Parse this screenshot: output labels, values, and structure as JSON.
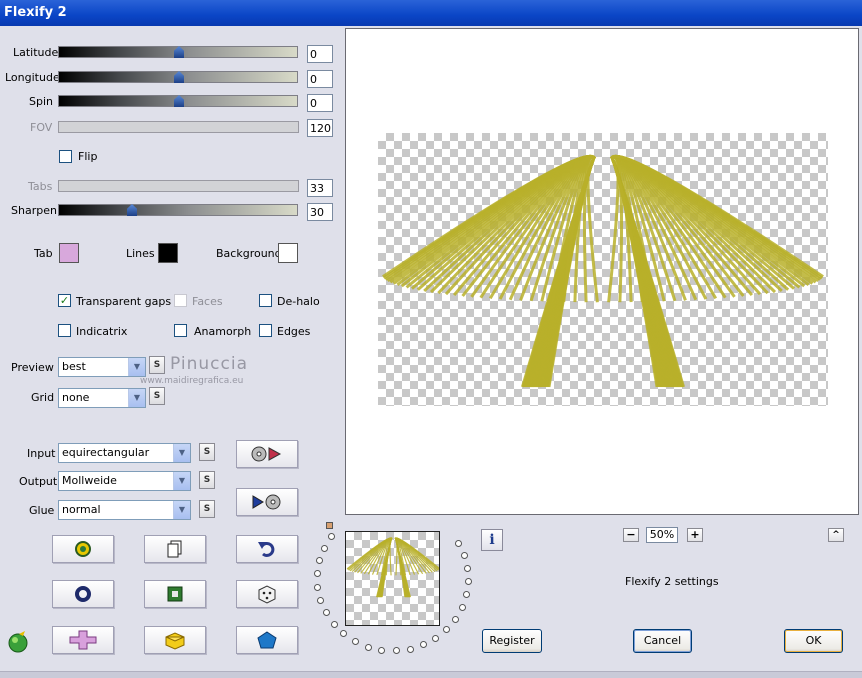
{
  "window": {
    "title": "Flexify 2"
  },
  "sliders": {
    "latitude": {
      "label": "Latitude",
      "value": "0"
    },
    "longitude": {
      "label": "Longitude",
      "value": "0"
    },
    "spin": {
      "label": "Spin",
      "value": "0"
    },
    "fov": {
      "label": "FOV",
      "value": "120"
    },
    "tabs": {
      "label": "Tabs",
      "value": "33"
    },
    "sharpen": {
      "label": "Sharpen",
      "value": "30"
    }
  },
  "flip": {
    "label": "Flip",
    "checked": false
  },
  "colors": {
    "tab": {
      "label": "Tab",
      "hex": "#d8a8dc"
    },
    "lines": {
      "label": "Lines",
      "hex": "#000000"
    },
    "background": {
      "label": "Background",
      "hex": "#ffffff"
    }
  },
  "options": {
    "transparent_gaps": {
      "label": "Transparent gaps",
      "checked": true
    },
    "faces": {
      "label": "Faces",
      "checked": false
    },
    "de_halo": {
      "label": "De-halo",
      "checked": false
    },
    "indicatrix": {
      "label": "Indicatrix",
      "checked": false
    },
    "anamorph": {
      "label": "Anamorph",
      "checked": false
    },
    "edges": {
      "label": "Edges",
      "checked": false
    }
  },
  "preview_select": {
    "label": "Preview",
    "value": "best"
  },
  "grid_select": {
    "label": "Grid",
    "value": "none"
  },
  "input_select": {
    "label": "Input",
    "value": "equirectangular"
  },
  "output_select": {
    "label": "Output",
    "value": "Mollweide"
  },
  "glue_select": {
    "label": "Glue",
    "value": "normal"
  },
  "small_button": {
    "label": "S"
  },
  "watermark": {
    "name": "Pinuccia",
    "url": "www.maidiregrafica.eu"
  },
  "zoom": {
    "value": "50%",
    "minus": "−",
    "plus": "+"
  },
  "collapse_button": {
    "label": "^"
  },
  "settings_label": "Flexify 2 settings",
  "buttons": {
    "register": "Register",
    "cancel": "Cancel",
    "ok": "OK"
  },
  "info_icon": "i",
  "accent": {
    "curve": "#b8b02a"
  }
}
